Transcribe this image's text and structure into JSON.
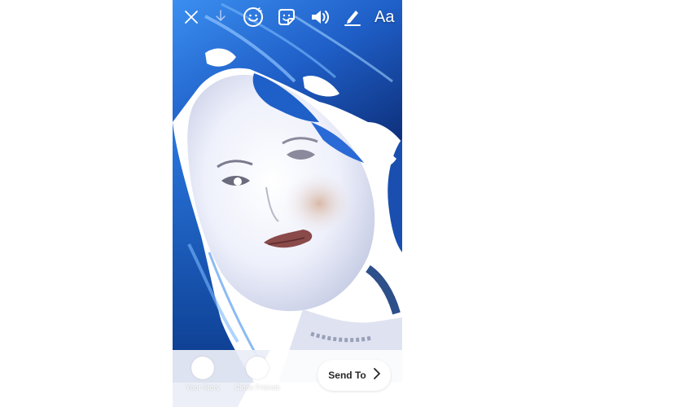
{
  "toolbar": {
    "close_icon": "close-icon",
    "download_icon": "download-icon",
    "face_filter_icon": "face-filter-icon",
    "sticker_icon": "sticker-icon",
    "sound_icon": "speaker-icon",
    "draw_icon": "pen-icon",
    "text_label": "Aa"
  },
  "share": {
    "your_story_label": "Your Story",
    "close_friends_label": "Close Friends"
  },
  "send": {
    "label": "Send To",
    "chevron_icon": "chevron-right-icon"
  },
  "colors": {
    "hair_blue": "#1f5fc8",
    "hair_dark": "#0d2f7a",
    "skin_light": "#f3f2ff",
    "background": "#ffffff"
  }
}
